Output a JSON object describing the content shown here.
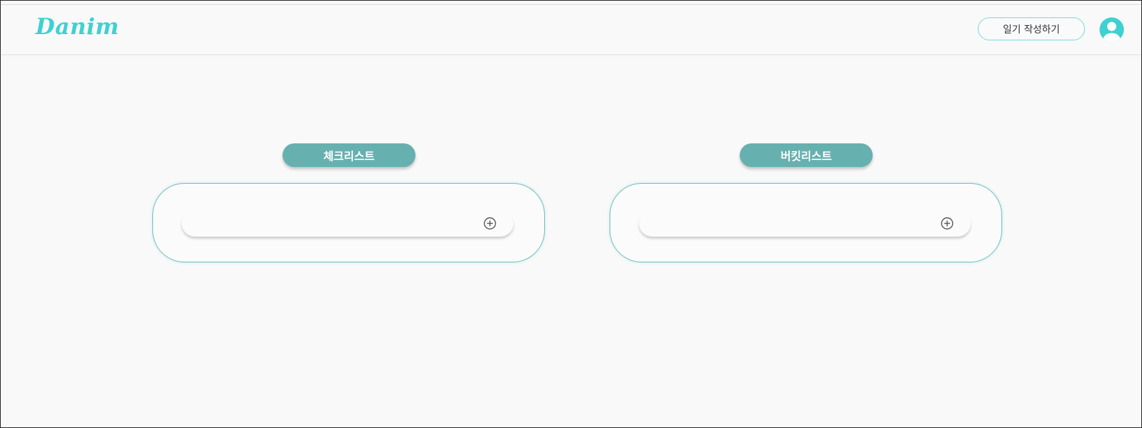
{
  "header": {
    "logo": "Danim",
    "write_button_label": "일기 작성하기",
    "avatar_icon": "user-icon"
  },
  "checklist": {
    "title": "체크리스트",
    "input_value": "",
    "add_icon": "plus-circle-icon"
  },
  "bucketlist": {
    "title": "버킷리스트",
    "input_value": "",
    "add_icon": "plus-circle-icon"
  },
  "colors": {
    "accent": "#3fd1d1",
    "pill": "#67b0b0",
    "card_border": "#6bbfbf",
    "background": "#f9f9f9"
  }
}
